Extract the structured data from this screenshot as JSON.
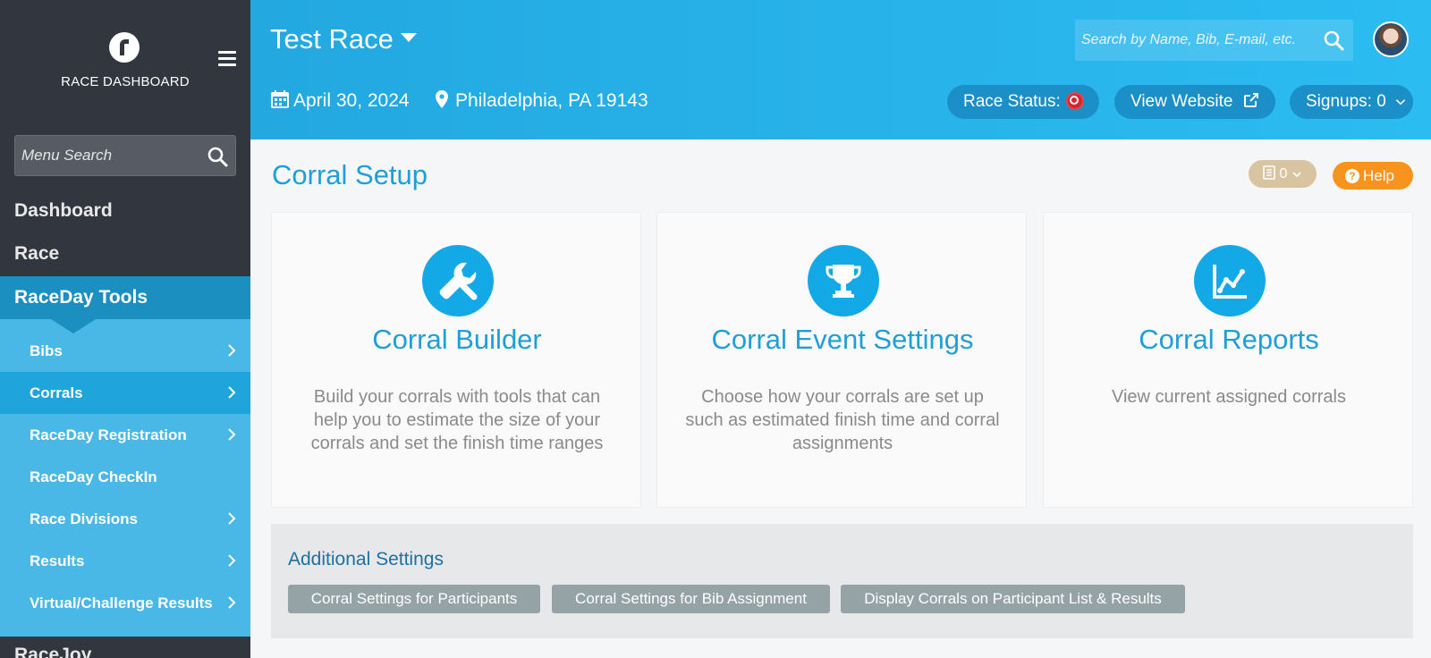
{
  "sidebar": {
    "brand": "RACE DASHBOARD",
    "search_placeholder": "Menu Search",
    "top_items": [
      "Dashboard",
      "Race"
    ],
    "active_section": "RaceDay Tools",
    "sub_items": [
      {
        "label": "Bibs",
        "has_arrow": true
      },
      {
        "label": "Corrals",
        "has_arrow": true,
        "current": true
      },
      {
        "label": "RaceDay Registration",
        "has_arrow": true
      },
      {
        "label": "RaceDay CheckIn",
        "has_arrow": false
      },
      {
        "label": "Race Divisions",
        "has_arrow": true
      },
      {
        "label": "Results",
        "has_arrow": true
      },
      {
        "label": "Virtual/Challenge Results",
        "has_arrow": true
      }
    ],
    "next_item": "RaceJoy"
  },
  "header": {
    "race_name": "Test Race",
    "search_placeholder": "Search by Name, Bib, E-mail, etc.",
    "date": "April 30, 2024",
    "location": "Philadelphia, PA 19143",
    "race_status_label": "Race Status:",
    "view_website_label": "View Website",
    "signups_label": "Signups: 0"
  },
  "main": {
    "title": "Corral Setup",
    "notes_count": "0",
    "help_label": "Help",
    "cards": [
      {
        "title": "Corral Builder",
        "icon": "wrench-icon",
        "desc": "Build your corrals with tools that can help you to estimate the size of your corrals and set the finish time ranges"
      },
      {
        "title": "Corral Event Settings",
        "icon": "trophy-icon",
        "desc": "Choose how your corrals are set up such as estimated finish time and corral assignments"
      },
      {
        "title": "Corral Reports",
        "icon": "chart-icon",
        "desc": "View current assigned corrals"
      }
    ],
    "additional": {
      "title": "Additional Settings",
      "buttons": [
        "Corral Settings for Participants",
        "Corral Settings for Bib Assignment",
        "Display Corrals on Participant List & Results"
      ]
    }
  },
  "colors": {
    "sidebar_bg": "#31363f",
    "accent_blue": "#1f9ed7",
    "header_blue": "#2bbcf2",
    "help_orange": "#f7941d",
    "status_red": "#d5262d"
  }
}
